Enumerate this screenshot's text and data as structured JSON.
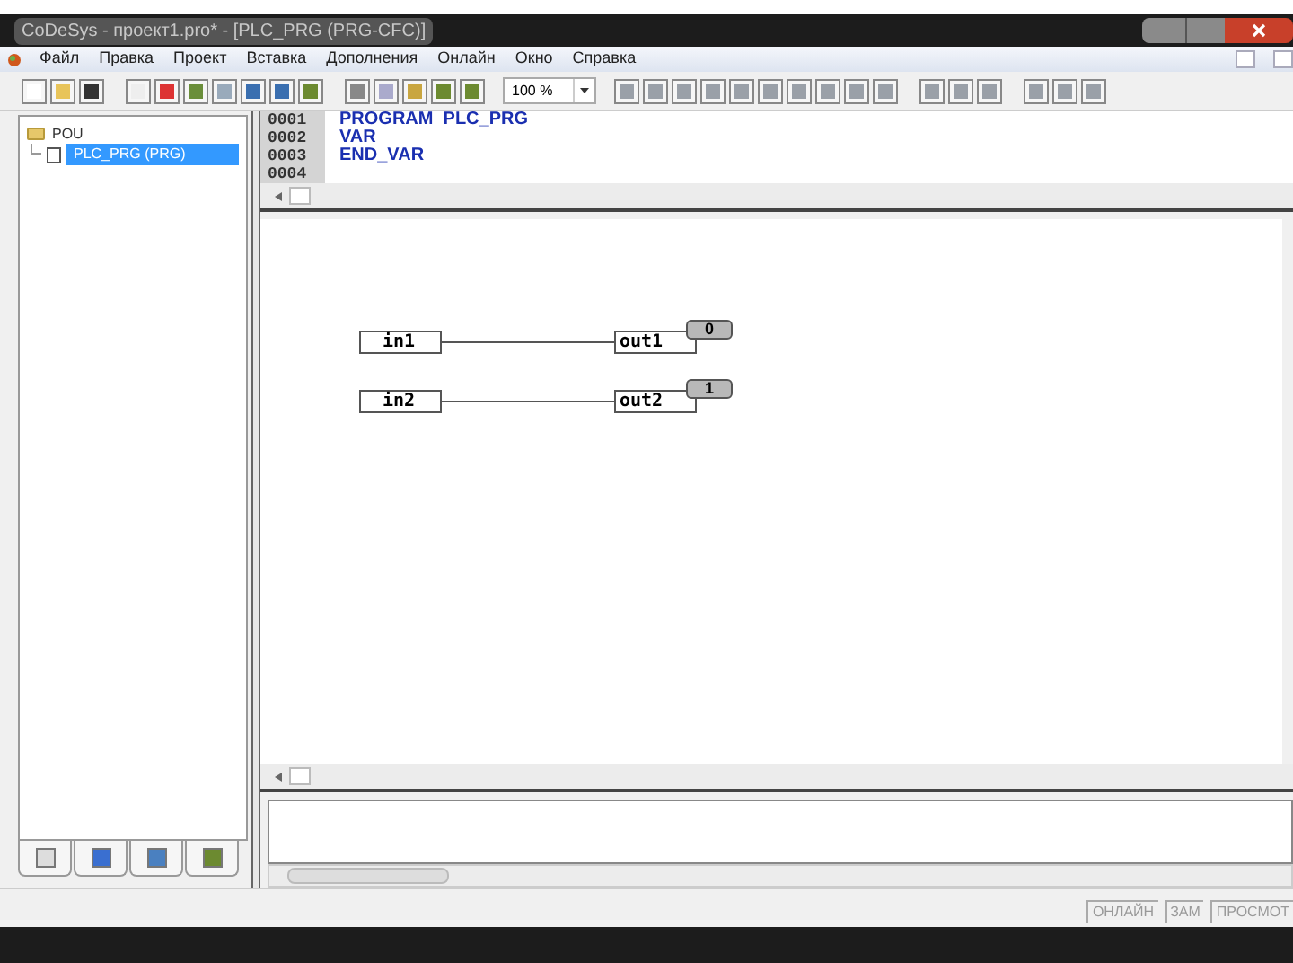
{
  "window": {
    "title": "CoDeSys - проект1.pro* - [PLC_PRG (PRG-CFC)]"
  },
  "menu": [
    "Файл",
    "Правка",
    "Проект",
    "Вставка",
    "Дополнения",
    "Онлайн",
    "Окно",
    "Справка"
  ],
  "toolbar": {
    "zoom": "100 %"
  },
  "tree": [
    {
      "label": "POU",
      "expanded": true,
      "children": [
        {
          "label": "PLC_PRG (PRG)",
          "selected": true
        }
      ]
    }
  ],
  "declaration": [
    {
      "number": "0001",
      "code": "PROGRAM  PLC_PRG"
    },
    {
      "number": "0002",
      "code": "VAR"
    },
    {
      "number": "0003",
      "code": "END_VAR"
    },
    {
      "number": "0004"
    }
  ],
  "cfc": [
    {
      "input": "in1",
      "output": "out1",
      "value": "0"
    },
    {
      "input": "in2",
      "output": "out2",
      "value": "1"
    }
  ],
  "status_bar": [
    "ОНЛАЙН",
    "ЗАМ",
    "ПРОСМОТ"
  ]
}
